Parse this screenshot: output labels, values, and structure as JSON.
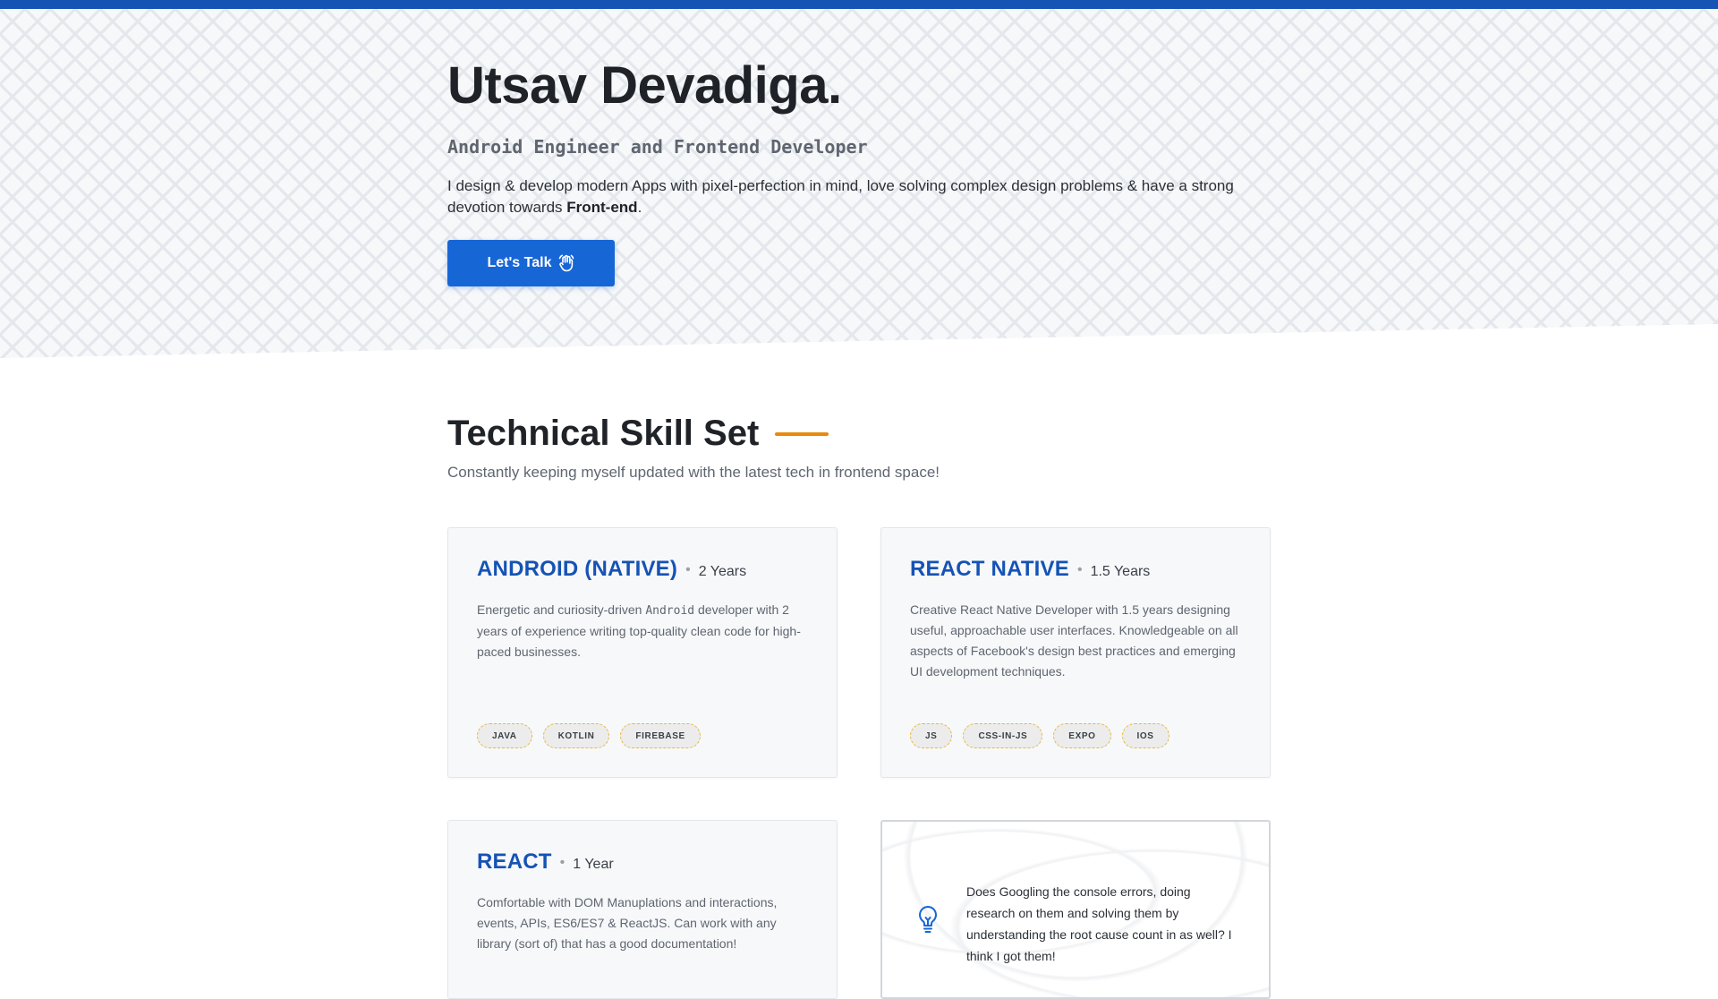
{
  "hero": {
    "title": "Utsav Devadiga.",
    "subtitle": "Android Engineer and Frontend Developer",
    "description_before": "I design & develop modern Apps with pixel-perfection in mind, love solving complex design problems & have a strong devotion towards ",
    "description_emphasis": "Front-end",
    "description_after": ".",
    "cta_label": "Let's Talk",
    "cta_icon": "waving-hand-icon"
  },
  "skills": {
    "title": "Technical Skill Set",
    "subtitle": "Constantly keeping myself updated with the latest tech in frontend space!",
    "cards": [
      {
        "title": "ANDROID (NATIVE)",
        "years": "2 Years",
        "desc_before": "Energetic and curiosity-driven ",
        "desc_code": "Android",
        "desc_after": " developer with 2 years of experience writing top-quality clean code for high-paced businesses.",
        "tags": [
          "JAVA",
          "KOTLIN",
          "FIREBASE"
        ]
      },
      {
        "title": "REACT NATIVE",
        "years": "1.5 Years",
        "desc": "Creative React Native Developer with 1.5 years designing useful, approachable user interfaces. Knowledgeable on all aspects of Facebook's design best practices and emerging UI development techniques.",
        "tags": [
          "JS",
          "CSS-IN-JS",
          "EXPO",
          "IOS"
        ]
      },
      {
        "title": "REACT",
        "years": "1 Year",
        "desc": "Comfortable with DOM Manuplations and interactions, events, APIs, ES6/ES7 & ReactJS. Can work with any library (sort of) that has a good documentation!"
      }
    ],
    "tip": {
      "icon": "lightbulb-icon",
      "text": "Does Googling the console errors, doing research on them and solving them by understanding the root cause count in as well? I think I got them!"
    }
  },
  "colors": {
    "brand": "#1553b5",
    "cta": "#1766d6",
    "accent": "#e88a0c",
    "tag_border": "#e9b93e"
  }
}
